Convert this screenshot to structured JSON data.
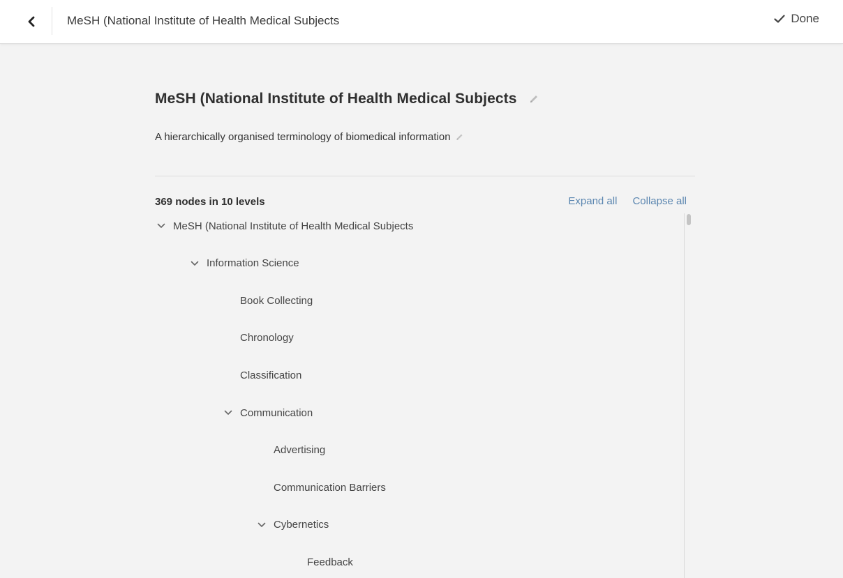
{
  "header": {
    "title": "MeSH (National Institute of Health Medical Subjects",
    "done_label": "Done"
  },
  "editor": {
    "title": "MeSH (National Institute of Health Medical Subjects",
    "description": "A hierarchically organised terminology of biomedical information"
  },
  "tree": {
    "summary": "369 nodes in 10 levels",
    "expand_all": "Expand all",
    "collapse_all": "Collapse all",
    "nodes": [
      {
        "label": "MeSH (National Institute of Health Medical Subjects",
        "depth": 0,
        "expanded": true
      },
      {
        "label": "Information Science",
        "depth": 1,
        "expanded": true
      },
      {
        "label": "Book Collecting",
        "depth": 2,
        "expanded": null
      },
      {
        "label": "Chronology",
        "depth": 2,
        "expanded": null
      },
      {
        "label": "Classification",
        "depth": 2,
        "expanded": null
      },
      {
        "label": "Communication",
        "depth": 2,
        "expanded": true
      },
      {
        "label": "Advertising",
        "depth": 3,
        "expanded": null
      },
      {
        "label": "Communication Barriers",
        "depth": 3,
        "expanded": null
      },
      {
        "label": "Cybernetics",
        "depth": 3,
        "expanded": true
      },
      {
        "label": "Feedback",
        "depth": 4,
        "expanded": null
      }
    ]
  },
  "colors": {
    "link": "#5b86b0",
    "background": "#f3f3f3",
    "header_background": "#ffffff"
  }
}
